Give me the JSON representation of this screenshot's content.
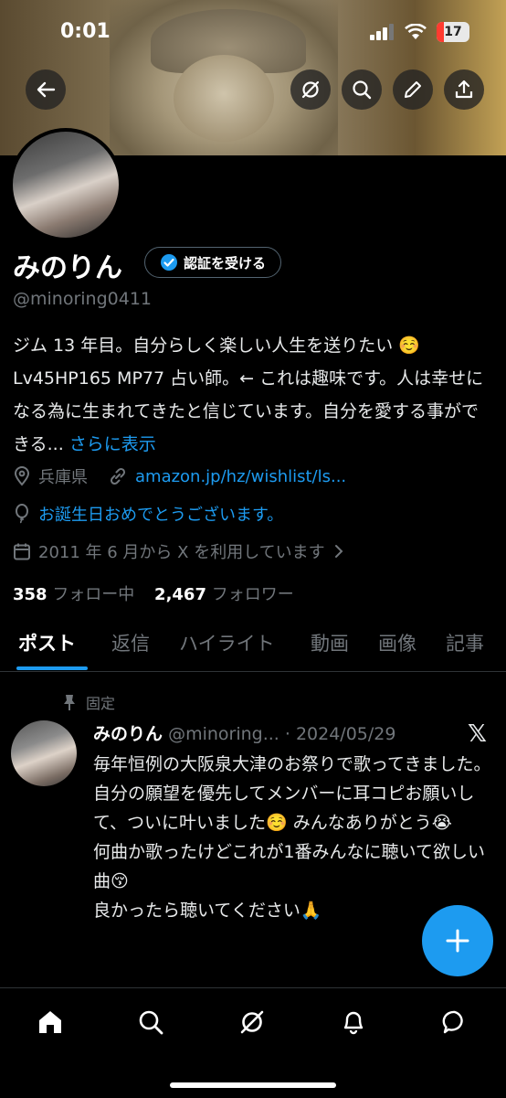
{
  "status_bar": {
    "time": "0:01",
    "battery": "17"
  },
  "profile": {
    "name": "みのりん",
    "verify_label": "認証を受ける",
    "handle": "@minoring0411",
    "bio_text": "ジム 13 年目。自分らしく楽しい人生を送りたい ☺️ Lv45HP165 MP77 占い師。← これは趣味です。人は幸せになる為に生まれてきたと信じています。自分を愛する事ができる...",
    "bio_more": "さらに表示",
    "location": "兵庫県",
    "link": "amazon.jp/hz/wishlist/ls...",
    "birthday": "お誕生日おめでとうございます。",
    "joined": "2011 年 6 月から X を利用しています",
    "following_count": "358",
    "following_label": "フォロー中",
    "followers_count": "2,467",
    "followers_label": "フォロワー"
  },
  "tabs": [
    "ポスト",
    "返信",
    "ハイライト",
    "動画",
    "画像",
    "記事"
  ],
  "post": {
    "pinned_label": "固定",
    "name": "みのりん",
    "handle": "@minoring...",
    "date": "· 2024/05/29",
    "text": "毎年恒例の大阪泉大津のお祭りで歌ってきました。\n自分の願望を優先してメンバーに耳コピお願いして、ついに叶いました☺️ みんなありがとう😭\n何曲か歌ったけどこれが1番みんなに聴いて欲しい曲😚\n良かったら聴いてください🙏"
  },
  "icons": {
    "back": "arrow-left-icon",
    "grok": "grok-icon",
    "search": "search-icon",
    "edit": "pencil-icon",
    "share": "share-icon",
    "x_logo": "x-logo-icon"
  },
  "colors": {
    "accent": "#1d9bf0",
    "background": "#000000",
    "muted": "#71767b"
  }
}
